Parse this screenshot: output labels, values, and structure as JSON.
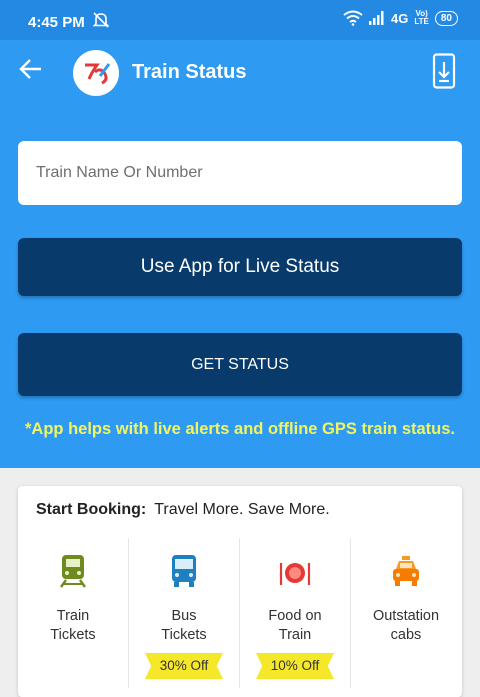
{
  "status_bar": {
    "time": "4:45 PM",
    "network": "4G",
    "network_sub": "Vo)\nLTE",
    "battery": "80"
  },
  "app_bar": {
    "title": "Train Status",
    "back_icon": "back-arrow-icon",
    "download_icon": "download-phone-icon"
  },
  "form": {
    "placeholder": "Train Name Or Number",
    "value": "",
    "live_button": "Use App for Live Status",
    "get_status_button": "GET STATUS",
    "note": "*App helps with live alerts and offline GPS train status."
  },
  "booking": {
    "header_bold": "Start Booking:",
    "header_text": "Travel More. Save More.",
    "options": [
      {
        "label": "Train\nTickets",
        "icon": "train-icon",
        "offer": ""
      },
      {
        "label": "Bus\nTickets",
        "icon": "bus-icon",
        "offer": "30% Off"
      },
      {
        "label": "Food on\nTrain",
        "icon": "food-plate-icon",
        "offer": "10% Off"
      },
      {
        "label": "Outstation\ncabs",
        "icon": "taxi-icon",
        "offer": ""
      }
    ]
  },
  "colors": {
    "primary": "#2e9af2",
    "status_bar": "#2389e3",
    "button_dark": "#083a6c",
    "note_yellow": "#f3f560",
    "offer_yellow": "#f5e82a"
  }
}
